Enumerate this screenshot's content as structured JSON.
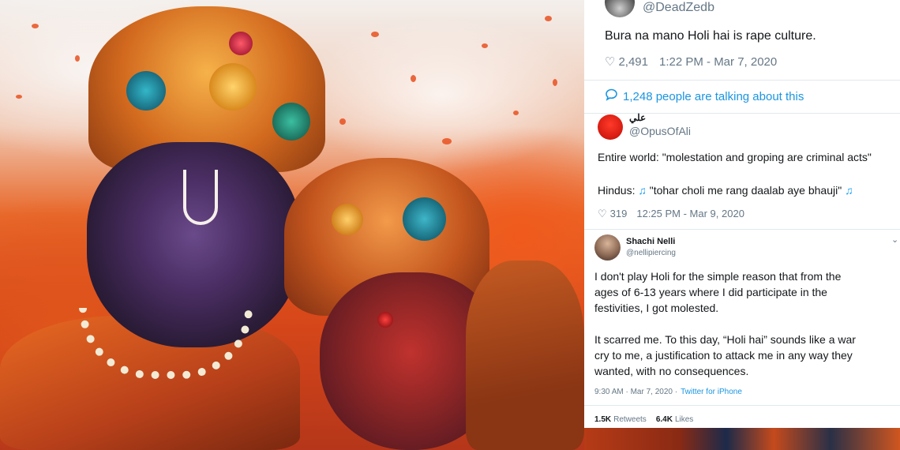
{
  "tweet1": {
    "handle": "@DeadZedb",
    "text": "Bura na mano Holi hai is rape culture.",
    "likes": "2,491",
    "timestamp": "1:22 PM - Mar 7, 2020",
    "talking": "1,248 people are talking about this"
  },
  "tweet2": {
    "display_name": "علي",
    "handle": "@OpusOfAli",
    "line1": "Entire world: \"molestation and groping are criminal acts\"",
    "line2_prefix": "Hindus:",
    "line2_quote": "\"tohar choli me rang daalab aye bhauji\"",
    "note_glyph": "♫",
    "likes": "319",
    "timestamp": "12:25 PM - Mar 9, 2020"
  },
  "tweet3": {
    "display_name": "Shachi Nelli",
    "handle": "@nellipiercing",
    "para1_line1": "I don't play Holi for the simple reason that from the",
    "para1_line2": "ages of 6-13 years where I did participate in the",
    "para1_line3": "festivities, I got molested.",
    "para2_line1": "It scarred me. To this day, “Holi hai” sounds like a war",
    "para2_line2": "cry to me, a justification to attack me in any way they",
    "para2_line3": "wanted, with no consequences.",
    "time": "9:30 AM · Mar 7, 2020 ·",
    "source": "Twitter for iPhone",
    "retweets_count": "1.5K",
    "retweets_label": "Retweets",
    "likes_count": "6.4K",
    "likes_label": "Likes"
  },
  "colors": {
    "twitter_blue": "#1b95e0",
    "muted": "#657786",
    "text": "#14171a"
  },
  "icons": [
    "heart-icon",
    "speech-bubble-icon",
    "music-note-icon",
    "chevron-down-icon"
  ]
}
